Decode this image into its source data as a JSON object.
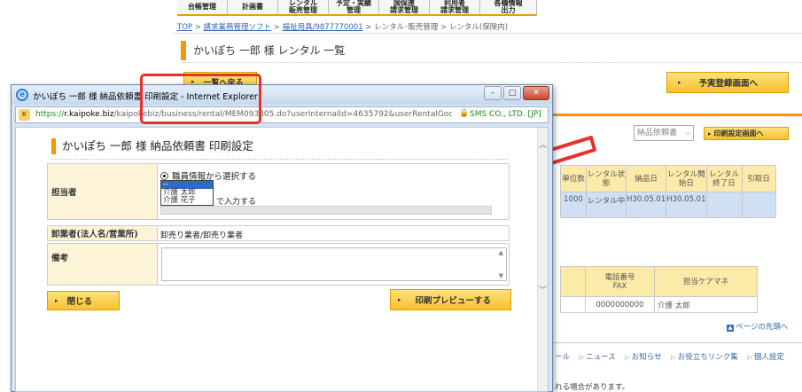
{
  "nav": [
    "台帳管理",
    "計画書",
    "レンタル\n販売管理",
    "予定・実績\n管理",
    "国保連\n請求管理",
    "利用者\n請求管理",
    "各種情報\n出力"
  ],
  "breadcrumb": {
    "top": "TOP",
    "software": "請求業務管理ソフト",
    "product": "福祉用具/9877770001",
    "rental_mgmt": "レンタル･販売管理",
    "rental_insured": "レンタル(保険内)"
  },
  "bg_page": {
    "title": "かいぽち 一郎 様 レンタル 一覧",
    "back_button": "一覧へ戻る",
    "plan_button": "予実登録画面へ",
    "select_value": "納品依頼書",
    "print_settings_button": "印刷設定画面へ",
    "table1": {
      "headers": [
        "単位数",
        "レンタル状態",
        "納品日",
        "レンタル開始日",
        "レンタル終了日",
        "引取日"
      ],
      "row": [
        "1000",
        "レンタル中",
        "H30.05.01",
        "H30.05.01",
        "",
        ""
      ]
    },
    "table2": {
      "headers": [
        "電話番号\nFAX",
        "担当ケアマネ"
      ],
      "row": [
        "0000000000",
        "介護 太郎"
      ]
    },
    "page_top": "ページの先頭へ",
    "footer_links": [
      "ール",
      "ニュース",
      "お知らせ",
      "お役立ちリンク集",
      "個人設定"
    ],
    "footer_note": "れる場合があります。"
  },
  "popup": {
    "window_title": "かいぽち 一郎 様 納品依頼書 印刷設定 - Internet Explorer",
    "url_https": "https://",
    "url_host": "r.kaipoke.biz",
    "url_path": "/kaipokebiz/business/rental/MEM093805.do?userInternalId=4635792&userRentalGoodsI",
    "cert": "SMS CO., LTD. [JP]",
    "heading": "かいぽち 一郎 様  納品依頼書  印刷設定",
    "staff_label": "担当者",
    "radio_label": "職員情報から選択する",
    "list_options": [
      "--",
      "介護 太郎",
      "介護 花子"
    ],
    "manual_label": "で入力する",
    "wholesaler_label": "卸業者(法人名/営業所)",
    "wholesaler_value": "卸売り業者/卸売り業者",
    "remarks_label": "備考",
    "close_button": "閉じる",
    "preview_button": "印刷プレビューする"
  },
  "colors": {
    "accent_orange": "#f39800",
    "button_yellow": "#f7c12e",
    "highlight_red": "#e8302b",
    "row_blue": "#cfe0f5"
  }
}
